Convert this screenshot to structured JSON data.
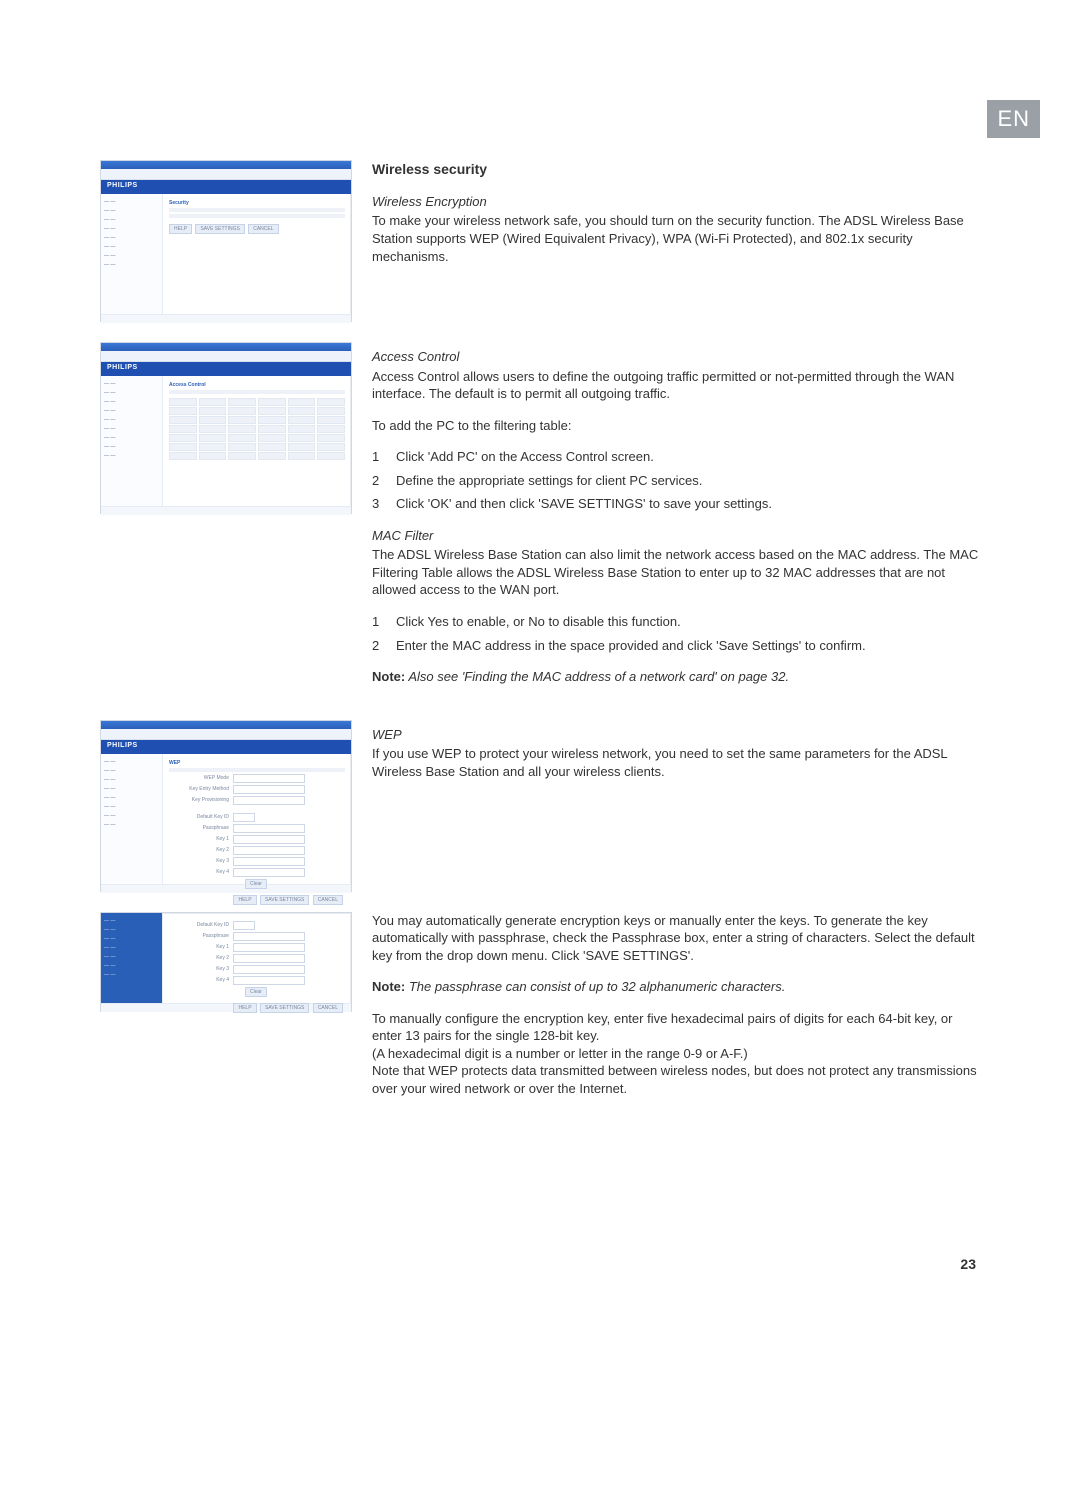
{
  "lang_badge": "EN",
  "page_number": "23",
  "section_heading": "Wireless security",
  "wireless_encryption": {
    "heading": "Wireless Encryption",
    "para": "To make your wireless network safe, you should turn on the security function. The ADSL Wireless Base Station supports WEP (Wired Equivalent Privacy), WPA (Wi-Fi Protected), and 802.1x security mechanisms."
  },
  "access_control": {
    "heading": "Access Control",
    "para": "Access Control allows users to define the outgoing traffic permitted or not-permitted through the WAN interface. The default is to permit all outgoing traffic.",
    "lead": "To add the PC to the filtering table:",
    "steps": [
      "Click 'Add PC' on the Access Control screen.",
      "Define the appropriate settings for client PC services.",
      "Click 'OK' and then click 'SAVE SETTINGS' to save your settings."
    ]
  },
  "mac_filter": {
    "heading": "MAC Filter",
    "para": "The ADSL Wireless Base Station can also limit the network access based on the MAC address. The MAC Filtering Table allows the ADSL Wireless Base Station to enter up to 32 MAC addresses that are not allowed access to the WAN port.",
    "steps": [
      "Click Yes to enable, or No to disable this function.",
      "Enter the MAC address in the space provided and click 'Save Settings' to confirm."
    ],
    "note_label": "Note:",
    "note_body": " Also see 'Finding the MAC address of a network card' on page 32."
  },
  "wep": {
    "heading": "WEP",
    "para1": "If you use WEP to protect your wireless network, you need to set the same parameters for the ADSL Wireless Base Station and all your wireless clients.",
    "para2": "You may automatically generate encryption keys or manually enter the keys. To generate the key automatically with passphrase, check the Passphrase box, enter a string of characters. Select the default key from the drop down menu. Click 'SAVE SETTINGS'.",
    "note_label": "Note:",
    "note_body": " The passphrase can consist of up to 32 alphanumeric characters.",
    "para3a": "To manually configure the encryption key, enter five hexadecimal pairs of digits for each 64-bit key, or enter 13 pairs for the single 128-bit key.",
    "para3b": "(A hexadecimal digit is a number or letter in the range 0-9 or A-F.)",
    "para3c": "Note that WEP protects data transmitted between wireless nodes, but does not protect any transmissions over your wired network or over the Internet."
  },
  "figure_brand": "PHILIPS",
  "figure_panel_title_1": "Security",
  "figure_panel_title_2": "Access Control",
  "figure_panel_title_3": "WEP",
  "figure_buttons": {
    "help": "HELP",
    "save": "SAVE SETTINGS",
    "cancel": "CANCEL",
    "clear": "Clear"
  },
  "wep_fields": {
    "wep_mode": "WEP Mode",
    "key_type": "Key Entry Method",
    "key_prov": "Key Provisioning",
    "default_key": "Default Key ID",
    "passphrase": "Passphrase",
    "key1": "Key 1",
    "key2": "Key 2",
    "key3": "Key 3",
    "key4": "Key 4"
  }
}
